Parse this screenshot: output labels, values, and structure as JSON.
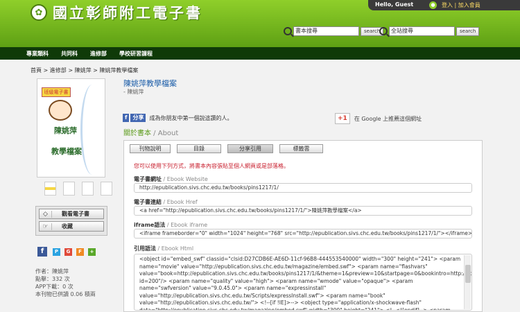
{
  "header": {
    "site_title": "國立彰師附工電子書",
    "greeting": "Hello, Guest",
    "links": "登入 | 加入會員",
    "search1_value": "書本搜尋",
    "search2_value": "全站搜尋",
    "search_label": "search"
  },
  "nav": [
    "專業類科",
    "共同科",
    "進修部",
    "學校研習課程"
  ],
  "breadcrumb": "首頁 > 進修部 > 陳姚萍 > 陳姚萍教學檔案",
  "cover": {
    "badge": "班級電子書",
    "title1": "陳姚萍",
    "title2": "教學檔案"
  },
  "actions": {
    "view": "觀看電子書",
    "collect": "收藏"
  },
  "share_icons": [
    "facebook",
    "plurk",
    "google-plus",
    "funp",
    "share-more"
  ],
  "stats": {
    "author": "作者：陳姚萍",
    "views": "點擊：332 次",
    "app_downloads": "APP下載：0 次",
    "copies": "本刊物已供讀 0.06 積兩"
  },
  "book": {
    "title": "陳姚萍教學檔案",
    "author": "- 陳姚萍",
    "fb_label": "分享",
    "fb_text": "成為你朋友中第一個說這讚的人。",
    "gplus_label": "+1",
    "gplus_text": "在 Google 上推薦這個網址",
    "about": "關於書本",
    "about_en": " / About"
  },
  "tabs": [
    "刊物說明",
    "目錄",
    "分享引用",
    "標籤雲"
  ],
  "hint": "您可以使用下列方式，將書本內容張貼至個人網頁或是部落格。",
  "fields": [
    {
      "label": "電子書網址",
      "label_en": " / Ebook Website",
      "value": "http://epublication.sivs.chc.edu.tw/books/pins1217/1/"
    },
    {
      "label": "電子書連結",
      "label_en": " / Ebook Href",
      "value": "<a href=\"http://epublication.sivs.chc.edu.tw/books/pins1217/1/\">陳姚萍教學檔案</a>"
    },
    {
      "label": "iframe語法",
      "label_en": " / Ebook iframe",
      "value": "<iframe frameborder=\"0\" width=\"1024\" height=\"768\" src=\"http://epublication.sivs.chc.edu.tw/books/pins1217/1/\"></iframe>"
    }
  ],
  "html_label": "引用語法",
  "html_label_en": " / Ebook Html",
  "html_code": "<object id=\"embed_swf\" classid=\"clsid:D27CDB6E-AE6D-11cf-96B8-444553540000\" width=\"300\" height=\"241\"> <param name=\"movie\" value=\"http://epublication.sivs.chc.edu.tw/magazine/embed.swf\"> <param name=\"flashvars\" value=\"book=http://epublication.sivs.chc.edu.tw/books/pins1217/1/&theme=1&preview=10&startpage=0&bookintro=http://epublication.sivs.chc.edu.tw/bookintro.php?id=200\"/> <param name=\"quality\" value=\"high\"> <param name=\"wmode\" value=\"opaque\"> <param name=\"swfversion\" value=\"9.0.45.0\"> <param name=\"expressinstall\" value=\"http://epublication.sivs.chc.edu.tw/Scripts/expressInstall.swf\"> <param name=\"book\" value=\"http://epublication.sivs.chc.edu.tw/\"> <!--[if !IE]>--> <object type=\"application/x-shockwave-flash\" data=\"http://epublication.sivs.chc.edu.tw/magazine/embed.swf\" width=\"300\" height=\"241\"> <!--<![endif]--> <param name=\"quality\" value=\"high\"> <param name=\"flashvars\""
}
